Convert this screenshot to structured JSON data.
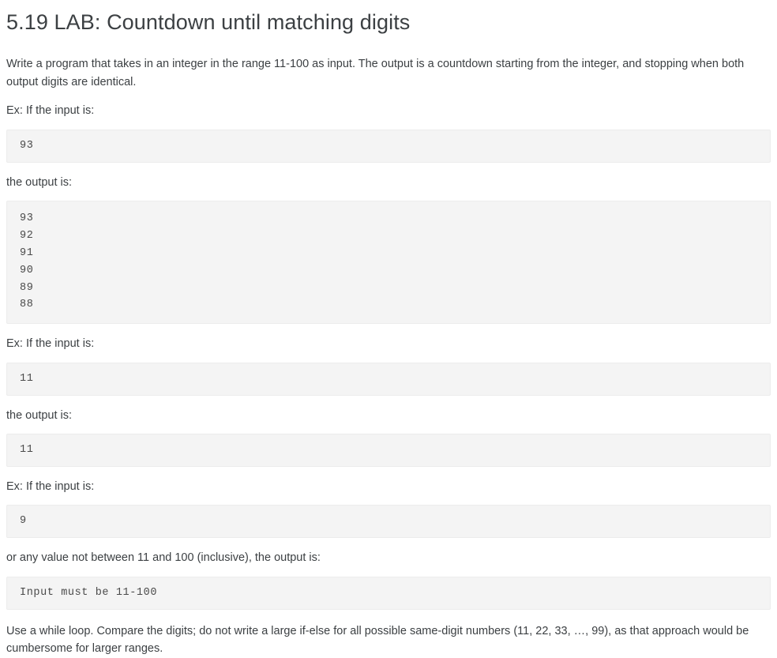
{
  "lab": {
    "title": "5.19 LAB: Countdown until matching digits",
    "description": "Write a program that takes in an integer in the range 11-100 as input. The output is a countdown starting from the integer, and stopping when both output digits are identical.",
    "closing_note": "Use a while loop. Compare the digits; do not write a large if-else for all possible same-digit numbers (11, 22, 33, …, 99), as that approach would be cumbersome for larger ranges."
  },
  "labels": {
    "input_prompt": "Ex: If the input is:",
    "output_prompt": "the output is:",
    "out_of_range_prompt": "or any value not between 11 and 100 (inclusive), the output is:"
  },
  "examples": [
    {
      "input": "93",
      "output": "93\n92\n91\n90\n89\n88"
    },
    {
      "input": "11",
      "output": "11"
    },
    {
      "input": "9",
      "output": "Input must be 11-100"
    }
  ]
}
